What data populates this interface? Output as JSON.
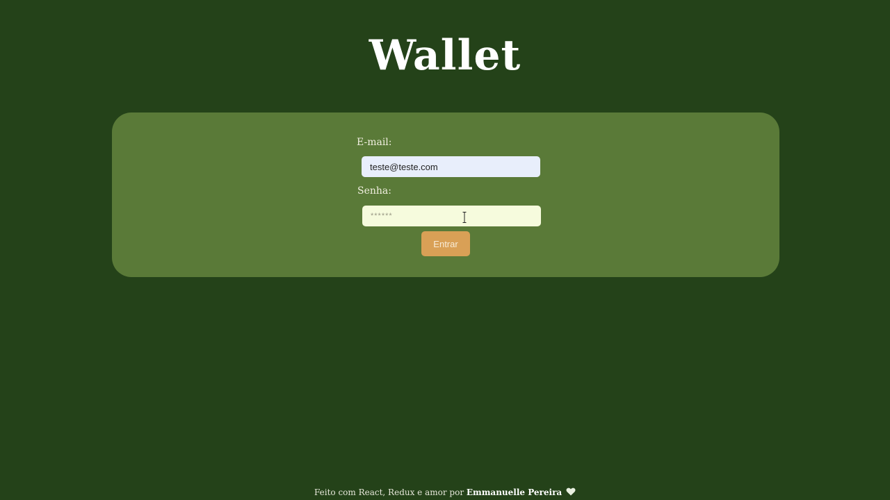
{
  "header": {
    "title": "Wallet"
  },
  "login_form": {
    "email_label": "E-mail:",
    "email_value": "teste@teste.com",
    "password_label": "Senha:",
    "password_placeholder": "******",
    "submit_label": "Entrar"
  },
  "footer": {
    "text": "Feito com React, Redux e amor por",
    "author": "Emmanuelle Pereira",
    "icon": "heart-icon"
  },
  "colors": {
    "background": "#244219",
    "card": "#5a7a38",
    "button": "#d9a056"
  }
}
